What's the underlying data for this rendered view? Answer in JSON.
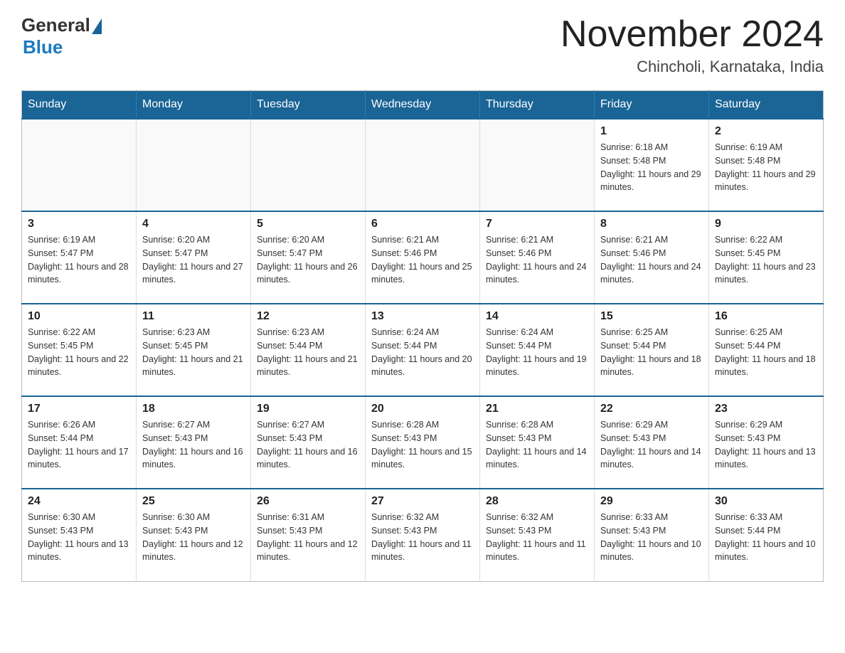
{
  "header": {
    "logo_general": "General",
    "logo_blue": "Blue",
    "month_title": "November 2024",
    "location": "Chincholi, Karnataka, India"
  },
  "days_of_week": [
    "Sunday",
    "Monday",
    "Tuesday",
    "Wednesday",
    "Thursday",
    "Friday",
    "Saturday"
  ],
  "weeks": [
    {
      "days": [
        {
          "number": "",
          "info": "",
          "empty": true
        },
        {
          "number": "",
          "info": "",
          "empty": true
        },
        {
          "number": "",
          "info": "",
          "empty": true
        },
        {
          "number": "",
          "info": "",
          "empty": true
        },
        {
          "number": "",
          "info": "",
          "empty": true
        },
        {
          "number": "1",
          "info": "Sunrise: 6:18 AM\nSunset: 5:48 PM\nDaylight: 11 hours and 29 minutes.",
          "empty": false
        },
        {
          "number": "2",
          "info": "Sunrise: 6:19 AM\nSunset: 5:48 PM\nDaylight: 11 hours and 29 minutes.",
          "empty": false
        }
      ]
    },
    {
      "days": [
        {
          "number": "3",
          "info": "Sunrise: 6:19 AM\nSunset: 5:47 PM\nDaylight: 11 hours and 28 minutes.",
          "empty": false
        },
        {
          "number": "4",
          "info": "Sunrise: 6:20 AM\nSunset: 5:47 PM\nDaylight: 11 hours and 27 minutes.",
          "empty": false
        },
        {
          "number": "5",
          "info": "Sunrise: 6:20 AM\nSunset: 5:47 PM\nDaylight: 11 hours and 26 minutes.",
          "empty": false
        },
        {
          "number": "6",
          "info": "Sunrise: 6:21 AM\nSunset: 5:46 PM\nDaylight: 11 hours and 25 minutes.",
          "empty": false
        },
        {
          "number": "7",
          "info": "Sunrise: 6:21 AM\nSunset: 5:46 PM\nDaylight: 11 hours and 24 minutes.",
          "empty": false
        },
        {
          "number": "8",
          "info": "Sunrise: 6:21 AM\nSunset: 5:46 PM\nDaylight: 11 hours and 24 minutes.",
          "empty": false
        },
        {
          "number": "9",
          "info": "Sunrise: 6:22 AM\nSunset: 5:45 PM\nDaylight: 11 hours and 23 minutes.",
          "empty": false
        }
      ]
    },
    {
      "days": [
        {
          "number": "10",
          "info": "Sunrise: 6:22 AM\nSunset: 5:45 PM\nDaylight: 11 hours and 22 minutes.",
          "empty": false
        },
        {
          "number": "11",
          "info": "Sunrise: 6:23 AM\nSunset: 5:45 PM\nDaylight: 11 hours and 21 minutes.",
          "empty": false
        },
        {
          "number": "12",
          "info": "Sunrise: 6:23 AM\nSunset: 5:44 PM\nDaylight: 11 hours and 21 minutes.",
          "empty": false
        },
        {
          "number": "13",
          "info": "Sunrise: 6:24 AM\nSunset: 5:44 PM\nDaylight: 11 hours and 20 minutes.",
          "empty": false
        },
        {
          "number": "14",
          "info": "Sunrise: 6:24 AM\nSunset: 5:44 PM\nDaylight: 11 hours and 19 minutes.",
          "empty": false
        },
        {
          "number": "15",
          "info": "Sunrise: 6:25 AM\nSunset: 5:44 PM\nDaylight: 11 hours and 18 minutes.",
          "empty": false
        },
        {
          "number": "16",
          "info": "Sunrise: 6:25 AM\nSunset: 5:44 PM\nDaylight: 11 hours and 18 minutes.",
          "empty": false
        }
      ]
    },
    {
      "days": [
        {
          "number": "17",
          "info": "Sunrise: 6:26 AM\nSunset: 5:44 PM\nDaylight: 11 hours and 17 minutes.",
          "empty": false
        },
        {
          "number": "18",
          "info": "Sunrise: 6:27 AM\nSunset: 5:43 PM\nDaylight: 11 hours and 16 minutes.",
          "empty": false
        },
        {
          "number": "19",
          "info": "Sunrise: 6:27 AM\nSunset: 5:43 PM\nDaylight: 11 hours and 16 minutes.",
          "empty": false
        },
        {
          "number": "20",
          "info": "Sunrise: 6:28 AM\nSunset: 5:43 PM\nDaylight: 11 hours and 15 minutes.",
          "empty": false
        },
        {
          "number": "21",
          "info": "Sunrise: 6:28 AM\nSunset: 5:43 PM\nDaylight: 11 hours and 14 minutes.",
          "empty": false
        },
        {
          "number": "22",
          "info": "Sunrise: 6:29 AM\nSunset: 5:43 PM\nDaylight: 11 hours and 14 minutes.",
          "empty": false
        },
        {
          "number": "23",
          "info": "Sunrise: 6:29 AM\nSunset: 5:43 PM\nDaylight: 11 hours and 13 minutes.",
          "empty": false
        }
      ]
    },
    {
      "days": [
        {
          "number": "24",
          "info": "Sunrise: 6:30 AM\nSunset: 5:43 PM\nDaylight: 11 hours and 13 minutes.",
          "empty": false
        },
        {
          "number": "25",
          "info": "Sunrise: 6:30 AM\nSunset: 5:43 PM\nDaylight: 11 hours and 12 minutes.",
          "empty": false
        },
        {
          "number": "26",
          "info": "Sunrise: 6:31 AM\nSunset: 5:43 PM\nDaylight: 11 hours and 12 minutes.",
          "empty": false
        },
        {
          "number": "27",
          "info": "Sunrise: 6:32 AM\nSunset: 5:43 PM\nDaylight: 11 hours and 11 minutes.",
          "empty": false
        },
        {
          "number": "28",
          "info": "Sunrise: 6:32 AM\nSunset: 5:43 PM\nDaylight: 11 hours and 11 minutes.",
          "empty": false
        },
        {
          "number": "29",
          "info": "Sunrise: 6:33 AM\nSunset: 5:43 PM\nDaylight: 11 hours and 10 minutes.",
          "empty": false
        },
        {
          "number": "30",
          "info": "Sunrise: 6:33 AM\nSunset: 5:44 PM\nDaylight: 11 hours and 10 minutes.",
          "empty": false
        }
      ]
    }
  ]
}
